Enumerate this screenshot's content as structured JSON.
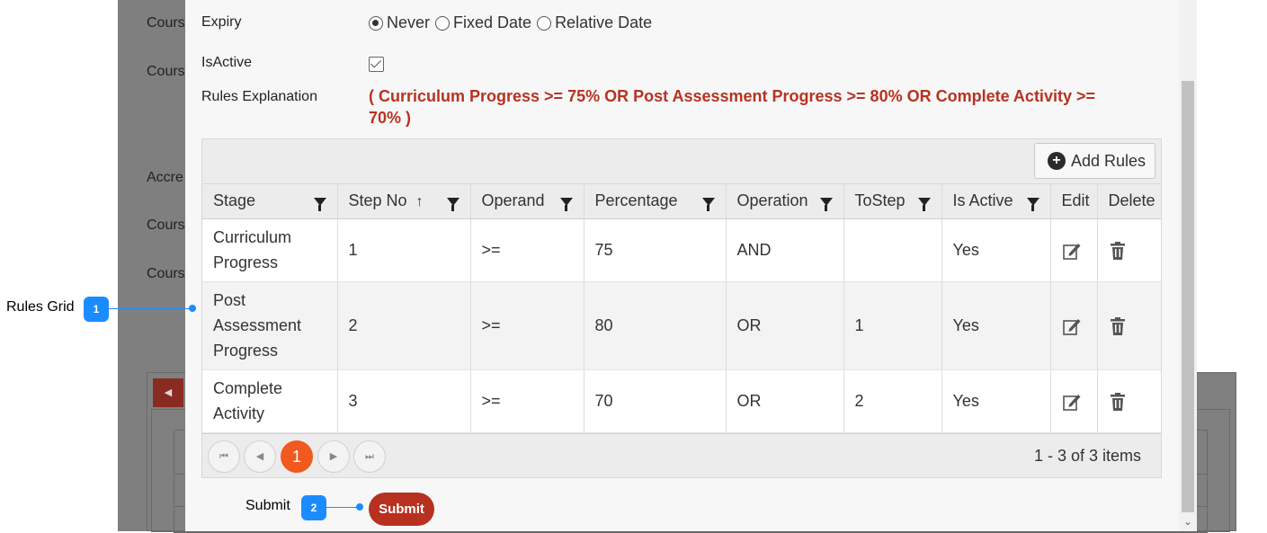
{
  "background": {
    "labels": [
      "Cours",
      "Cours",
      "Accre",
      "Cours",
      "Cours"
    ],
    "nav_icon": "triangle-left-icon"
  },
  "form": {
    "expiry_label": "Expiry",
    "expiry_options": [
      "Never",
      "Fixed Date",
      "Relative Date"
    ],
    "expiry_selected": "Never",
    "isactive_label": "IsActive",
    "isactive_checked": true,
    "rules_explanation_label": "Rules Explanation",
    "rules_explanation_line1": "( Curriculum Progress >= 75% OR Post Assessment Progress >= 80% OR Complete Activity >=",
    "rules_explanation_line2": "70% )",
    "accent_color": "#b83221"
  },
  "grid": {
    "add_button_label": "Add Rules",
    "columns": [
      "Stage",
      "Step No",
      "Operand",
      "Percentage",
      "Operation",
      "ToStep",
      "Is Active",
      "Edit",
      "Delete"
    ],
    "sort_indicator": "↑",
    "rows": [
      {
        "stage_1": "Curriculum",
        "stage_2": "Progress",
        "stage_3": "",
        "step_no": "1",
        "operand": ">=",
        "percentage": "75",
        "operation": "AND",
        "to_step": "",
        "is_active": "Yes"
      },
      {
        "stage_1": "Post",
        "stage_2": "Assessment",
        "stage_3": "Progress",
        "step_no": "2",
        "operand": ">=",
        "percentage": "80",
        "operation": "OR",
        "to_step": "1",
        "is_active": "Yes"
      },
      {
        "stage_1": "Complete",
        "stage_2": "Activity",
        "stage_3": "",
        "step_no": "3",
        "operand": ">=",
        "percentage": "70",
        "operation": "OR",
        "to_step": "2",
        "is_active": "Yes"
      }
    ],
    "pager": {
      "current_page": "1",
      "info": "1 - 3 of 3 items",
      "current_color": "#f05a1e"
    }
  },
  "submit_label": "Submit",
  "callouts": [
    {
      "number": "1",
      "label": "Rules Grid"
    },
    {
      "number": "2",
      "label": "Submit"
    }
  ]
}
